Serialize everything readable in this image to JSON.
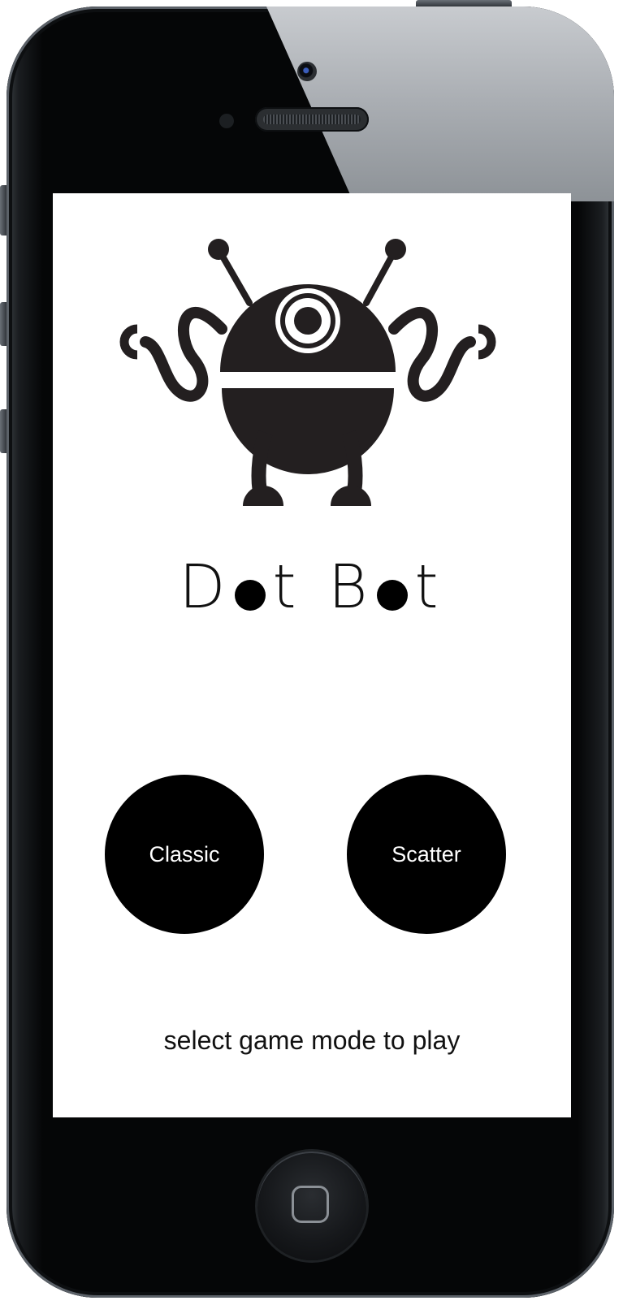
{
  "app": {
    "title_prefix": "D",
    "title_mid": "t B",
    "title_suffix": "t"
  },
  "modes": [
    {
      "label": "Classic"
    },
    {
      "label": "Scatter"
    }
  ],
  "hint": "select game mode to play",
  "colors": {
    "screen_bg": "#ffffff",
    "button_bg": "#000000",
    "button_text": "#ffffff",
    "robot": "#231f20"
  },
  "icons": {
    "logo": "robot-icon",
    "home": "home-button-icon"
  }
}
